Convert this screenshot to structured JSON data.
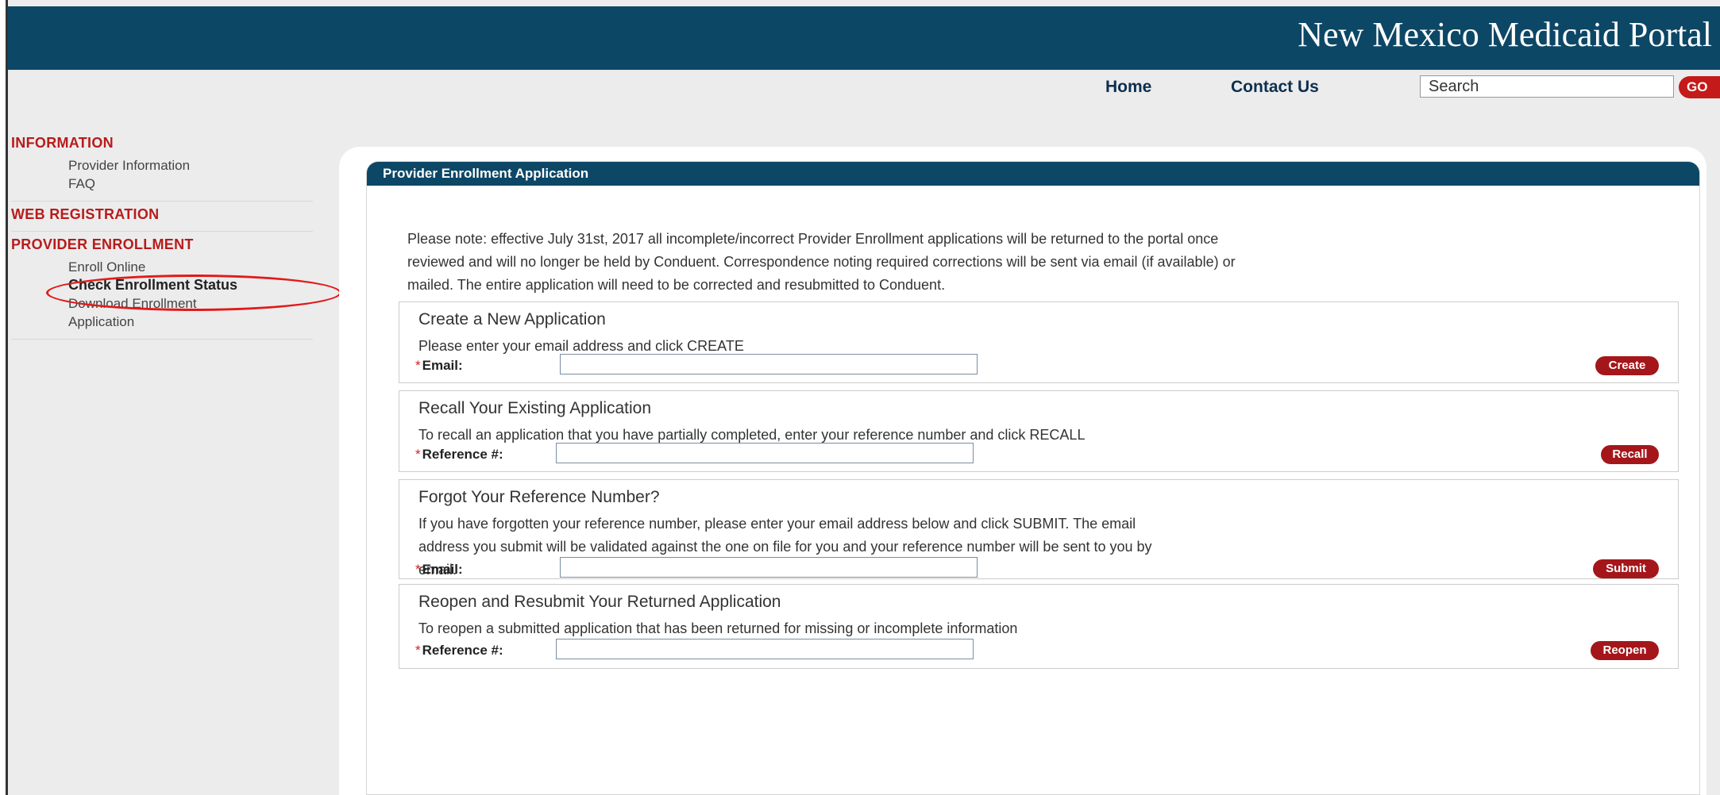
{
  "header": {
    "title": "New Mexico Medicaid Portal"
  },
  "topnav": {
    "home_label": "Home",
    "contact_label": "Contact Us",
    "search_value": "Search",
    "go_label": "GO"
  },
  "sidebar": {
    "information": {
      "heading": "INFORMATION",
      "items": [
        "Provider Information",
        "FAQ"
      ]
    },
    "web_registration": {
      "heading": "WEB REGISTRATION"
    },
    "provider_enrollment": {
      "heading": "PROVIDER ENROLLMENT",
      "items": [
        "Enroll Online",
        "Check Enrollment Status",
        "Download Enrollment",
        "Application"
      ]
    }
  },
  "panel": {
    "title": "Provider Enrollment Application",
    "notice_lines": [
      "Please note: effective July 31st, 2017 all incomplete/incorrect Provider Enrollment applications will be returned to the portal once",
      "reviewed and will no longer be held by Conduent. Correspondence noting required corrections will be sent via email (if available) or",
      "mailed. The entire application will need to be corrected and resubmitted to Conduent."
    ]
  },
  "sections": {
    "create": {
      "title": "Create a New Application",
      "desc_lines": [
        "Please enter your email address and click CREATE"
      ],
      "field_label": "Email:",
      "field_value": "",
      "button": "Create"
    },
    "recall": {
      "title": "Recall Your Existing Application",
      "desc_lines": [
        "To recall an application that you have partially completed, enter your reference number and click RECALL"
      ],
      "field_label": "Reference #:",
      "field_value": "",
      "button": "Recall"
    },
    "forgot": {
      "title": "Forgot Your Reference Number?",
      "desc_lines": [
        "If you have forgotten your reference number, please enter your email address below and click SUBMIT. The email",
        "address you submit will be validated against the one on file for you and your reference number will be sent to you by",
        "email."
      ],
      "field_label": "Email:",
      "field_value": "",
      "button": "Submit"
    },
    "reopen": {
      "title": "Reopen and Resubmit Your Returned Application",
      "desc_lines": [
        "To reopen a submitted application that has been returned for missing or incomplete information"
      ],
      "field_label": "Reference #:",
      "field_value": "",
      "button": "Reopen"
    }
  },
  "colors": {
    "header_bg": "#0d4766",
    "accent_red": "#b81b1b",
    "button_red": "#a4161a",
    "highlight_ring": "#e21a1a"
  }
}
